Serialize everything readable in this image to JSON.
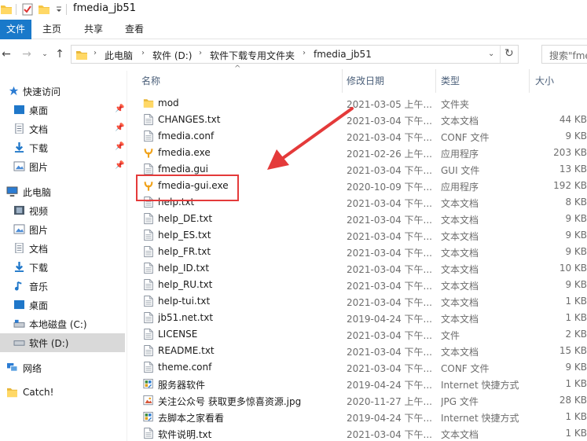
{
  "window": {
    "title": "fmedia_jb51"
  },
  "ribbon": {
    "tabs": [
      "文件",
      "主页",
      "共享",
      "查看"
    ]
  },
  "address": {
    "crumbs": [
      "此电脑",
      "软件 (D:)",
      "软件下载专用文件夹",
      "fmedia_jb51"
    ],
    "search_placeholder": "搜索\"fme"
  },
  "nav_pane": {
    "items": [
      {
        "label": "快速访问",
        "icon": "star-icon"
      },
      {
        "label": "桌面",
        "icon": "desktop-icon",
        "pinned": true
      },
      {
        "label": "文档",
        "icon": "documents-icon",
        "pinned": true
      },
      {
        "label": "下载",
        "icon": "download-icon",
        "pinned": true
      },
      {
        "label": "图片",
        "icon": "pictures-icon",
        "pinned": true
      },
      {
        "label": "此电脑",
        "icon": "computer-icon"
      },
      {
        "label": "视频",
        "icon": "video-icon"
      },
      {
        "label": "图片",
        "icon": "pictures-icon"
      },
      {
        "label": "文档",
        "icon": "documents-icon"
      },
      {
        "label": "下载",
        "icon": "download-icon"
      },
      {
        "label": "音乐",
        "icon": "music-icon"
      },
      {
        "label": "桌面",
        "icon": "desktop-icon"
      },
      {
        "label": "本地磁盘 (C:)",
        "icon": "drive-icon"
      },
      {
        "label": "软件 (D:)",
        "icon": "drive-icon",
        "selected": true
      },
      {
        "label": "网络",
        "icon": "network-icon"
      },
      {
        "label": "Catch!",
        "icon": "folder-icon"
      }
    ]
  },
  "file_list": {
    "columns": [
      "名称",
      "修改日期",
      "类型",
      "大小"
    ],
    "rows": [
      {
        "name": "mod",
        "date": "2021-03-05 上午...",
        "type": "文件夹",
        "size": "",
        "icon": "folder-icon"
      },
      {
        "name": "CHANGES.txt",
        "date": "2021-03-04 下午...",
        "type": "文本文档",
        "size": "44 KB",
        "icon": "text-file-icon"
      },
      {
        "name": "fmedia.conf",
        "date": "2021-03-04 下午...",
        "type": "CONF 文件",
        "size": "9 KB",
        "icon": "text-file-icon"
      },
      {
        "name": "fmedia.exe",
        "date": "2021-02-26 上午...",
        "type": "应用程序",
        "size": "203 KB",
        "icon": "fmedia-app-icon"
      },
      {
        "name": "fmedia.gui",
        "date": "2021-03-04 下午...",
        "type": "GUI 文件",
        "size": "13 KB",
        "icon": "text-file-icon"
      },
      {
        "name": "fmedia-gui.exe",
        "date": "2020-10-09 下午...",
        "type": "应用程序",
        "size": "192 KB",
        "icon": "fmedia-app-icon"
      },
      {
        "name": "help.txt",
        "date": "2021-03-04 下午...",
        "type": "文本文档",
        "size": "8 KB",
        "icon": "text-file-icon"
      },
      {
        "name": "help_DE.txt",
        "date": "2021-03-04 下午...",
        "type": "文本文档",
        "size": "9 KB",
        "icon": "text-file-icon"
      },
      {
        "name": "help_ES.txt",
        "date": "2021-03-04 下午...",
        "type": "文本文档",
        "size": "9 KB",
        "icon": "text-file-icon"
      },
      {
        "name": "help_FR.txt",
        "date": "2021-03-04 下午...",
        "type": "文本文档",
        "size": "9 KB",
        "icon": "text-file-icon"
      },
      {
        "name": "help_ID.txt",
        "date": "2021-03-04 下午...",
        "type": "文本文档",
        "size": "10 KB",
        "icon": "text-file-icon"
      },
      {
        "name": "help_RU.txt",
        "date": "2021-03-04 下午...",
        "type": "文本文档",
        "size": "9 KB",
        "icon": "text-file-icon"
      },
      {
        "name": "help-tui.txt",
        "date": "2021-03-04 下午...",
        "type": "文本文档",
        "size": "1 KB",
        "icon": "text-file-icon"
      },
      {
        "name": "jb51.net.txt",
        "date": "2019-04-24 下午...",
        "type": "文本文档",
        "size": "1 KB",
        "icon": "text-file-icon"
      },
      {
        "name": "LICENSE",
        "date": "2021-03-04 下午...",
        "type": "文件",
        "size": "2 KB",
        "icon": "text-file-icon"
      },
      {
        "name": "README.txt",
        "date": "2021-03-04 下午...",
        "type": "文本文档",
        "size": "15 KB",
        "icon": "text-file-icon"
      },
      {
        "name": "theme.conf",
        "date": "2021-03-04 下午...",
        "type": "CONF 文件",
        "size": "9 KB",
        "icon": "text-file-icon"
      },
      {
        "name": "服务器软件",
        "date": "2019-04-24 下午...",
        "type": "Internet 快捷方式",
        "size": "1 KB",
        "icon": "shortcut-icon"
      },
      {
        "name": "关注公众号 获取更多惊喜资源.jpg",
        "date": "2020-11-27 上午...",
        "type": "JPG 文件",
        "size": "28 KB",
        "icon": "image-file-icon"
      },
      {
        "name": "去脚本之家看看",
        "date": "2019-04-24 下午...",
        "type": "Internet 快捷方式",
        "size": "1 KB",
        "icon": "shortcut-icon"
      },
      {
        "name": "软件说明.txt",
        "date": "2021-03-04 下午...",
        "type": "文本文档",
        "size": "1 KB",
        "icon": "text-file-icon"
      }
    ]
  },
  "annotation": {
    "color": "#e43a3a",
    "target": "fmedia-gui.exe"
  }
}
